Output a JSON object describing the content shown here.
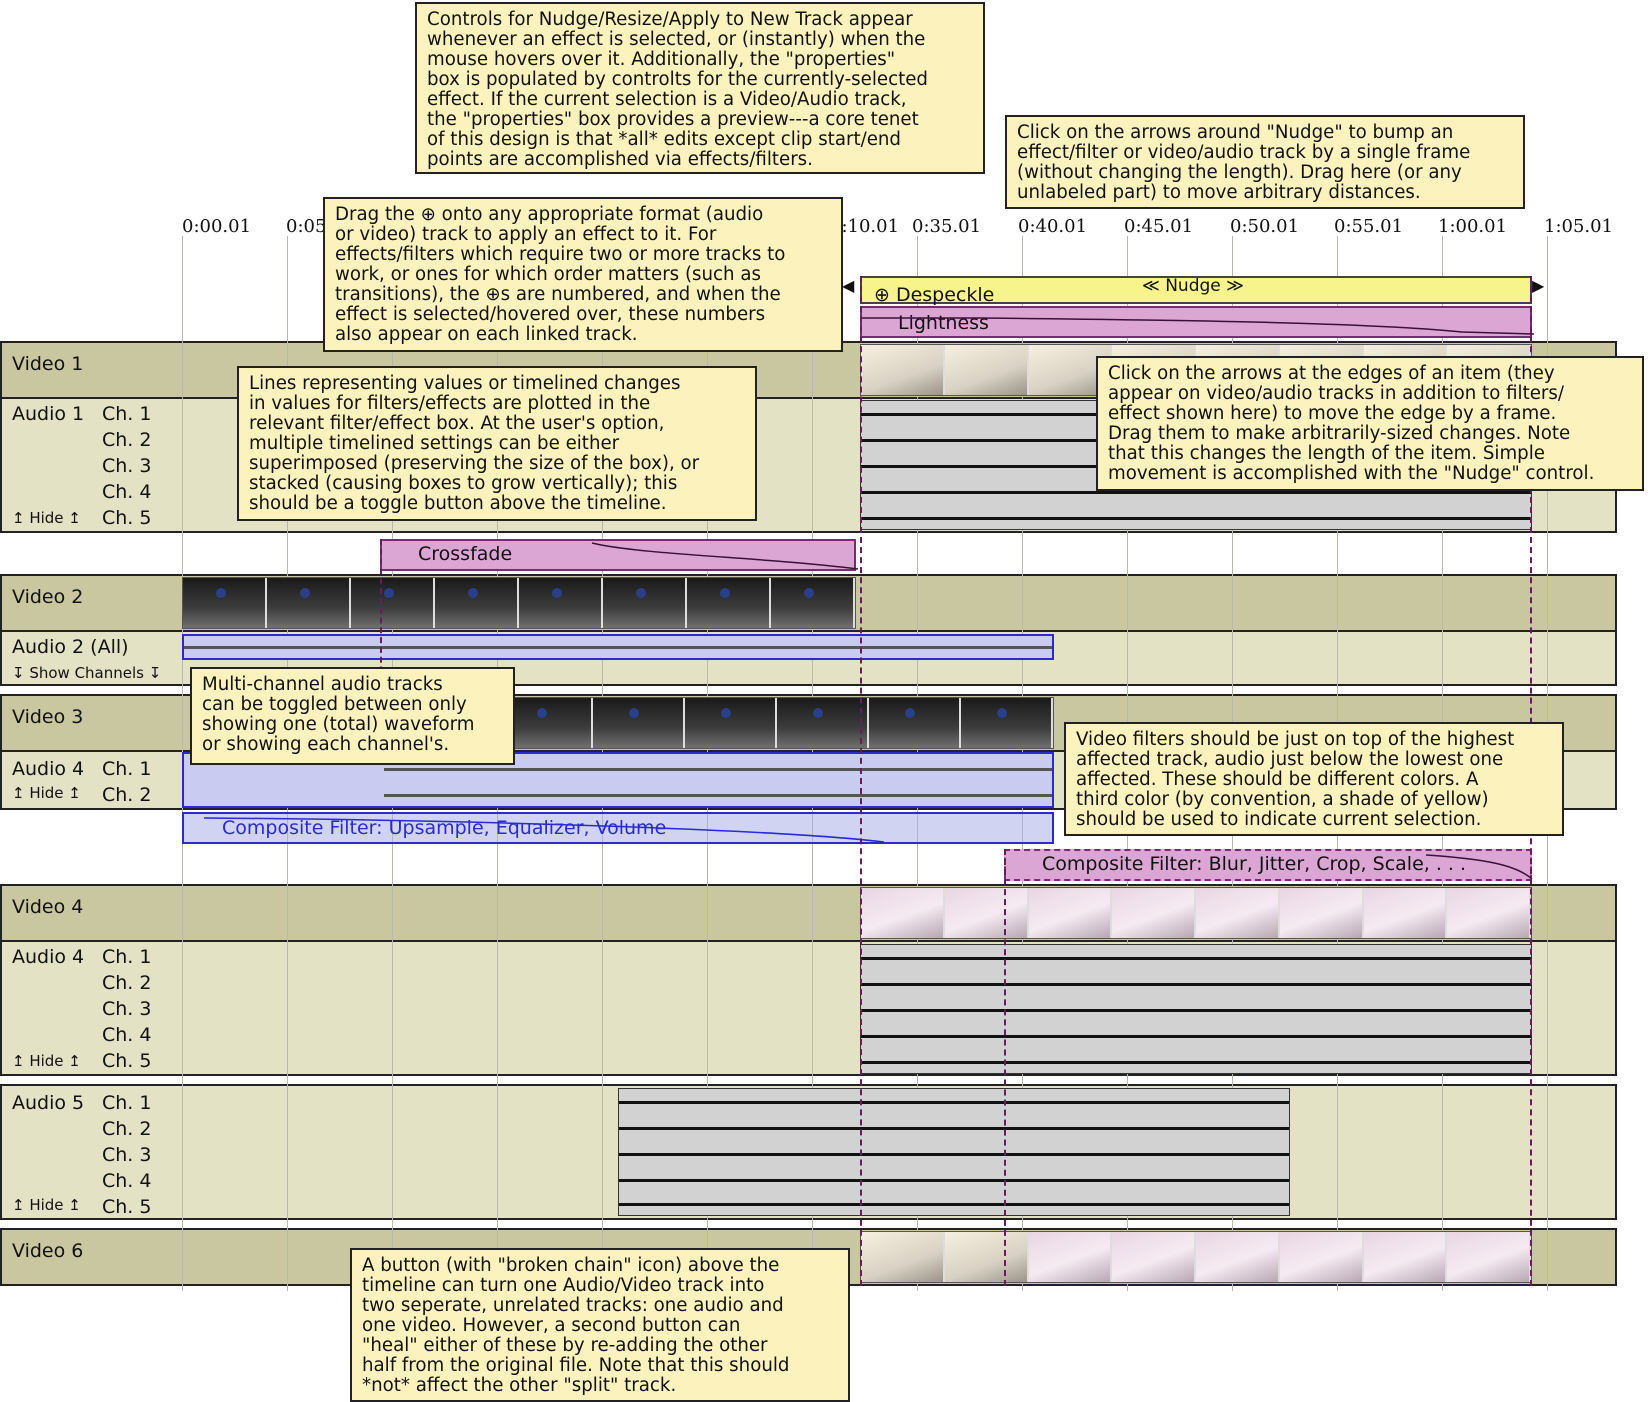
{
  "ruler": [
    "0:00.01",
    "0:05",
    "0:10.01",
    "0:35.01",
    "0:40.01",
    "0:45.01",
    "0:50.01",
    "0:55.01",
    "1:00.01",
    "1:05.01"
  ],
  "tracks": {
    "video1": "Video 1",
    "audio1": "Audio 1",
    "video2": "Video 2",
    "audio2": "Audio 2  (All)",
    "audio2_toggle": "↧ Show Channels ↧",
    "video3": "Video 3",
    "audio4a": "Audio 4",
    "video4": "Video 4",
    "audio4b": "Audio 4",
    "audio5": "Audio 5",
    "video6": "Video 6",
    "hide": "↥ Hide ↥",
    "ch1": "Ch. 1",
    "ch2": "Ch. 2",
    "ch3": "Ch. 3",
    "ch4": "Ch. 4",
    "ch5": "Ch. 5"
  },
  "filters": {
    "nudge": "≪ Nudge ≫",
    "despeckle": "⊕ Despeckle",
    "lightness": "Lightness",
    "crossfade": "Crossfade",
    "audio_composite": "Composite Filter:  Upsample, Equalizer, Volume",
    "video_composite": "Composite Filter:  Blur, Jitter, Crop, Scale, . . ."
  },
  "notes": {
    "controls": "Controls for Nudge/Resize/Apply to New Track appear\nwhenever an effect is selected, or (instantly) when the\nmouse hovers over it.  Additionally, the \"properties\"\nbox is populated by controlts for the currently-selected\neffect.  If the current selection is a Video/Audio track,\nthe \"properties\" box provides a preview---a core tenet\nof this design is that *all* edits except clip start/end\npoints are accomplished via effects/filters.",
    "nudge": "Click on the arrows around \"Nudge\" to bump an\neffect/filter or video/audio track by a single frame\n(without changing the length).  Drag here (or any\nunlabeled part) to move arbitrary distances.",
    "drag": "Drag the ⊕ onto any appropriate format (audio\nor video) track to apply an effect to it.  For\neffects/filters which require two or more tracks to\nwork, or ones for which order matters (such as\ntransitions), the ⊕s are numbered, and when the\neffect is selected/hovered over, these numbers\nalso appear on each linked track.",
    "lines": "Lines representing values or timelined changes\nin values for filters/effects are plotted in the\nrelevant filter/effect box.  At the user's option,\nmultiple timelined settings can be either\nsuperimposed (preserving the size of the box), or\nstacked (causing boxes to grow vertically); this\nshould be a toggle button above the timeline.",
    "edges": "Click on the arrows at the edges of an item (they\nappear on video/audio tracks in addition to filters/\neffect shown here) to move the edge by a frame.\nDrag them to make arbitrarily-sized changes.  Note\nthat this changes the length of the item.  Simple\nmovement is accomplished with the \"Nudge\" control.",
    "multichannel": "Multi-channel audio tracks\ncan be toggled between only\nshowing one (total) waveform\nor showing each channel's.",
    "placement": "Video filters should be just on top of the highest\naffected track, audio just below the lowest one\naffected.  These should be different colors.  A\nthird color (by convention, a shade of yellow)\nshould be used to indicate current selection.",
    "chain": "A button (with \"broken chain\" icon) above the\ntimeline can turn one Audio/Video track into\ntwo seperate, unrelated tracks: one audio and\none video.  However, a second button can\n\"heal\" either of these by re-adding the other\nhalf from the original file.  Note that this should\n*not* affect the other \"split\" track."
  },
  "colors": {
    "video_track": "#c9c7a0",
    "audio_track": "#e4e2c4",
    "note_bg": "#fbf2bd",
    "video_filter": "#dca6d4",
    "audio_filter": "#aaafe6",
    "selection": "#f6f48a"
  }
}
